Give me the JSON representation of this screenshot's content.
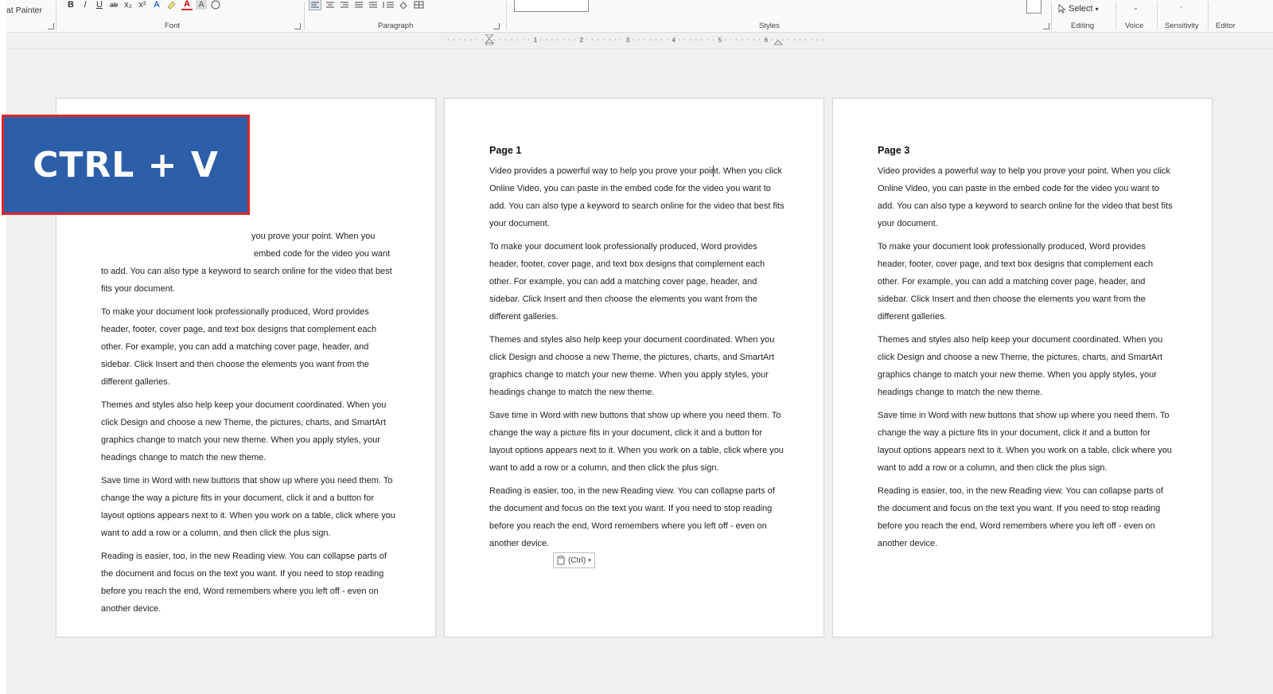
{
  "ribbon": {
    "format_painter": "at Painter",
    "groups": {
      "font": "Font",
      "paragraph": "Paragraph",
      "styles": "Styles",
      "editing": "Editing",
      "voice": "Voice",
      "sensitivity": "Sensitivity",
      "editor": "Editor"
    },
    "select_label": "Select",
    "font_buttons": [
      "B",
      "I",
      "U",
      "ab",
      "x₂",
      "x²",
      "A",
      "A",
      "A"
    ]
  },
  "ruler": {
    "marks": [
      "1",
      "2",
      "3",
      "4",
      "5",
      "6"
    ]
  },
  "overlay": {
    "text": "CTRL + V"
  },
  "paste_options": {
    "label": "(Ctrl)"
  },
  "pages": [
    {
      "title": "",
      "paragraphs": [
        "you prove your point. When you",
        "embed code for the video you want to add. You can also type a keyword to search online for the video that best fits your document.",
        "To make your document look professionally produced, Word provides header, footer, cover page, and text box designs that complement each other. For example, you can add a matching cover page, header, and sidebar. Click Insert and then choose the elements you want from the different galleries.",
        "Themes and styles also help keep your document coordinated. When you click Design and choose a new Theme, the pictures, charts, and SmartArt graphics change to match your new theme. When you apply styles, your headings change to match the new theme.",
        "Save time in Word with new buttons that show up where you need them. To change the way a picture fits in your document, click it and a button for layout options appears next to it. When you work on a table, click where you want to add a row or a column, and then click the plus sign.",
        "Reading is easier, too, in the new Reading view. You can collapse parts of the document and focus on the text you want. If you need to stop reading before you reach the end, Word remembers where you left off - even on another device."
      ]
    },
    {
      "title": "Page 1",
      "paragraphs": [
        "Video provides a powerful way to help you prove your point. When you click Online Video, you can paste in the embed code for the video you want to add. You can also type a keyword to search online for the video that best fits your document.",
        "To make your document look professionally produced, Word provides header, footer, cover page, and text box designs that complement each other. For example, you can add a matching cover page, header, and sidebar. Click Insert and then choose the elements you want from the different galleries.",
        "Themes and styles also help keep your document coordinated. When you click Design and choose a new Theme, the pictures, charts, and SmartArt graphics change to match your new theme. When you apply styles, your headings change to match the new theme.",
        "Save time in Word with new buttons that show up where you need them. To change the way a picture fits in your document, click it and a button for layout options appears next to it. When you work on a table, click where you want to add a row or a column, and then click the plus sign.",
        "Reading is easier, too, in the new Reading view. You can collapse parts of the document and focus on the text you want. If you need to stop reading before you reach the end, Word remembers where you left off - even on another device."
      ]
    },
    {
      "title": "Page 3",
      "paragraphs": [
        "Video provides a powerful way to help you prove your point. When you click Online Video, you can paste in the embed code for the video you want to add. You can also type a keyword to search online for the video that best fits your document.",
        "To make your document look professionally produced, Word provides header, footer, cover page, and text box designs that complement each other. For example, you can add a matching cover page, header, and sidebar. Click Insert and then choose the elements you want from the different galleries.",
        "Themes and styles also help keep your document coordinated. When you click Design and choose a new Theme, the pictures, charts, and SmartArt graphics change to match your new theme. When you apply styles, your headings change to match the new theme.",
        "Save time in Word with new buttons that show up where you need them. To change the way a picture fits in your document, click it and a button for layout options appears next to it. When you work on a table, click where you want to add a row or a column, and then click the plus sign.",
        "Reading is easier, too, in the new Reading view. You can collapse parts of the document and focus on the text you want. If you need to stop reading before you reach the end, Word remembers where you left off - even on another device."
      ]
    }
  ],
  "colors": {
    "overlay_bg": "#2c5fa8",
    "overlay_border": "#e0262a",
    "canvas": "#f0f0f0"
  }
}
